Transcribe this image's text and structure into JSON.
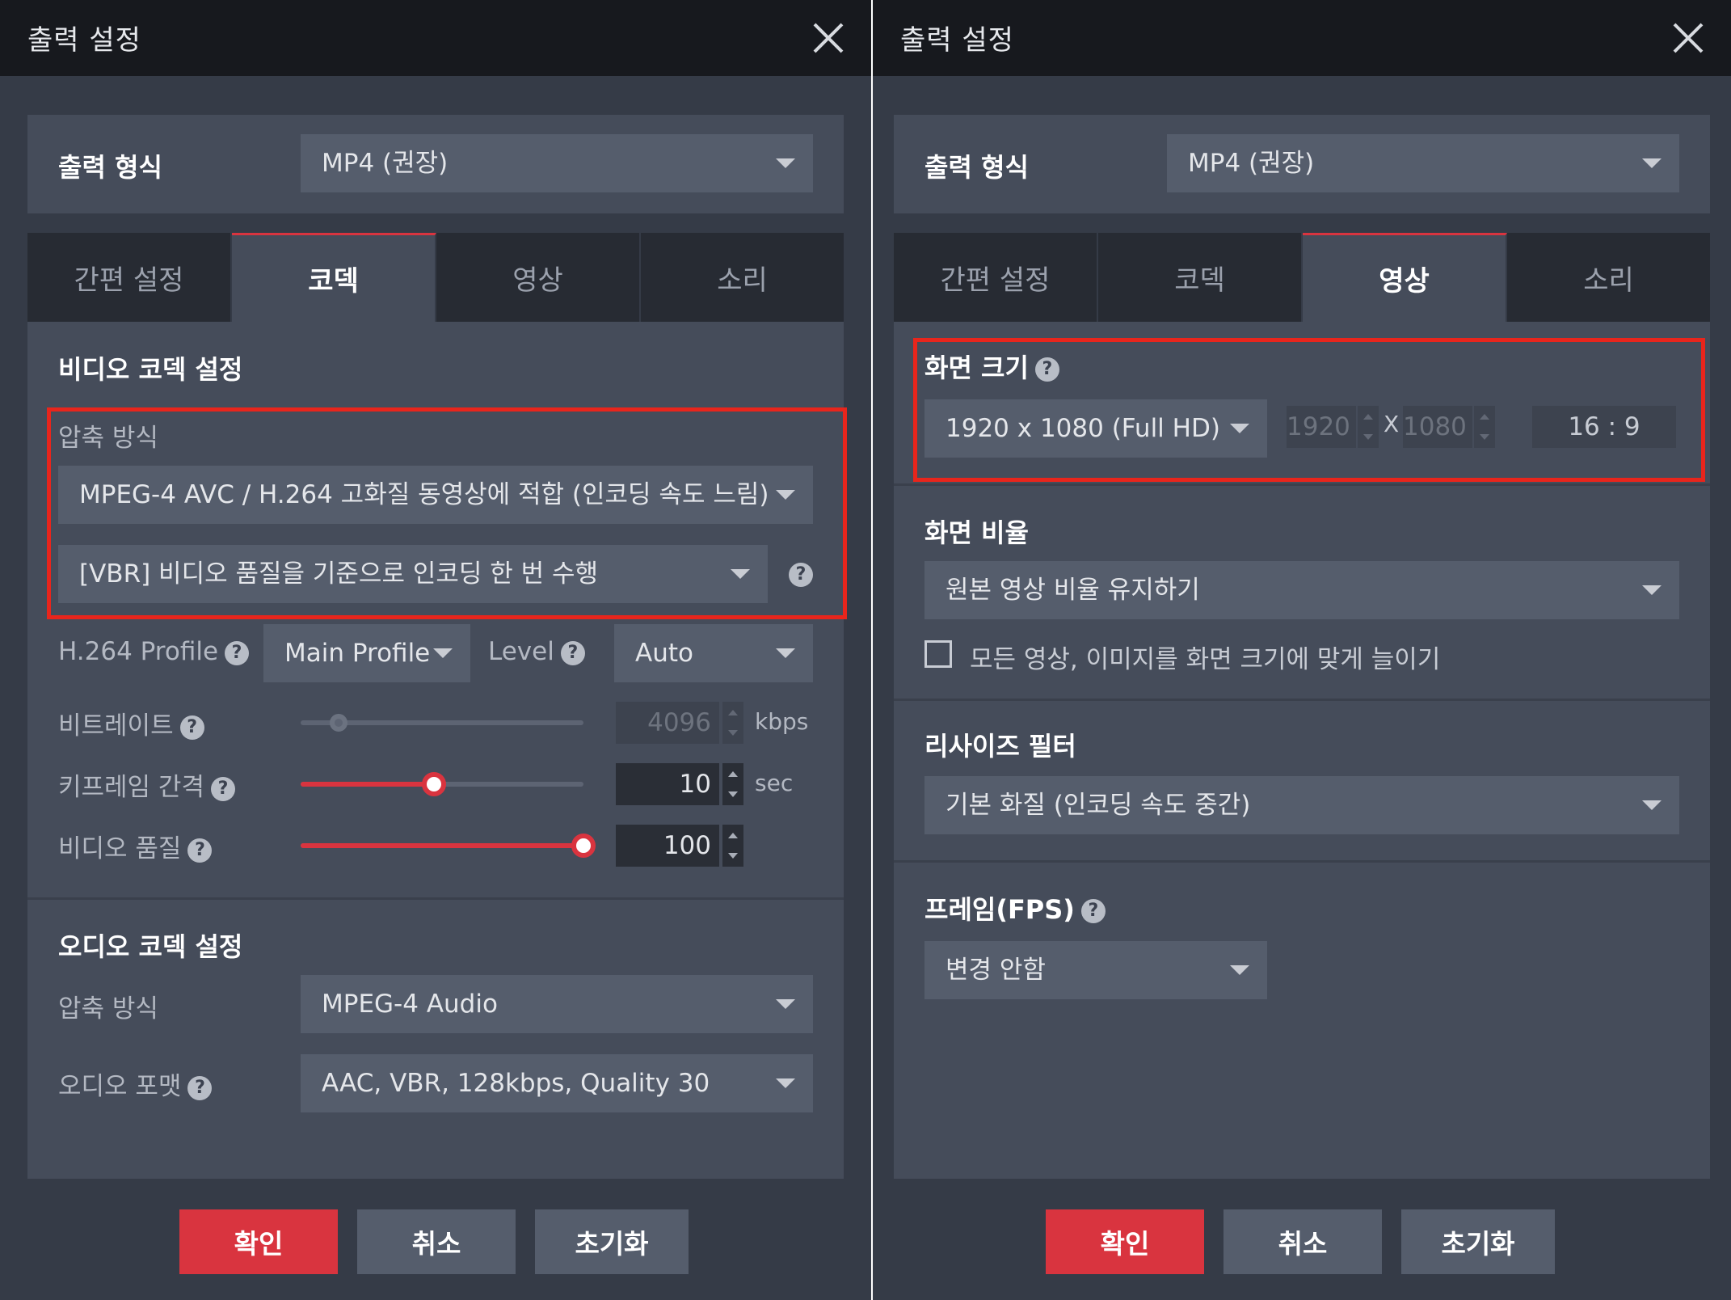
{
  "left": {
    "title": "출력 설정",
    "format_label": "출력 형식",
    "format_value": "MP4 (권장)",
    "tabs": [
      "간편 설정",
      "코덱",
      "영상",
      "소리"
    ],
    "video_codec_title": "비디오 코덱 설정",
    "compression_label": "압축 방식",
    "compression_value": "MPEG-4 AVC / H.264 고화질 동영상에 적합 (인코딩 속도 느림)",
    "mode_value": "[VBR] 비디오 품질을 기준으로 인코딩 한 번 수행",
    "profile_label": "H.264 Profile",
    "profile_value": "Main Profile",
    "level_label": "Level",
    "level_value": "Auto",
    "bitrate_label": "비트레이트",
    "bitrate_value": "4096",
    "bitrate_unit": "kbps",
    "keyframe_label": "키프레임 간격",
    "keyframe_value": "10",
    "keyframe_unit": "sec",
    "keyframe_level": 0.47,
    "quality_label": "비디오 품질",
    "quality_value": "100",
    "quality_level": 1.0,
    "audio_codec_title": "오디오 코덱 설정",
    "audio_compression_label": "압축 방식",
    "audio_compression_value": "MPEG-4 Audio",
    "audio_format_label": "오디오 포맷",
    "audio_format_value": "AAC, VBR, 128kbps, Quality 30"
  },
  "right": {
    "title": "출력 설정",
    "format_label": "출력 형식",
    "format_value": "MP4 (권장)",
    "tabs": [
      "간편 설정",
      "코덱",
      "영상",
      "소리"
    ],
    "screen_size_label": "화면 크기",
    "resolution_value": "1920 x 1080 (Full HD)",
    "width_value": "1920",
    "x_sep": "X",
    "height_value": "1080",
    "aspect_value": "16 : 9",
    "ratio_label": "화면 비율",
    "ratio_value": "원본 영상 비율 유지하기",
    "stretch_label": "모든 영상, 이미지를 화면 크기에 맞게 늘이기",
    "resize_label": "리사이즈 필터",
    "resize_value": "기본 화질 (인코딩 속도 중간)",
    "fps_label": "프레임(FPS)",
    "fps_value": "변경 안함"
  },
  "buttons": {
    "confirm": "확인",
    "cancel": "취소",
    "reset": "초기화"
  },
  "help_glyph": "?",
  "colors": {
    "accent": "#d9343f",
    "highlight": "#e8251c",
    "titlebar": "#17191e"
  }
}
